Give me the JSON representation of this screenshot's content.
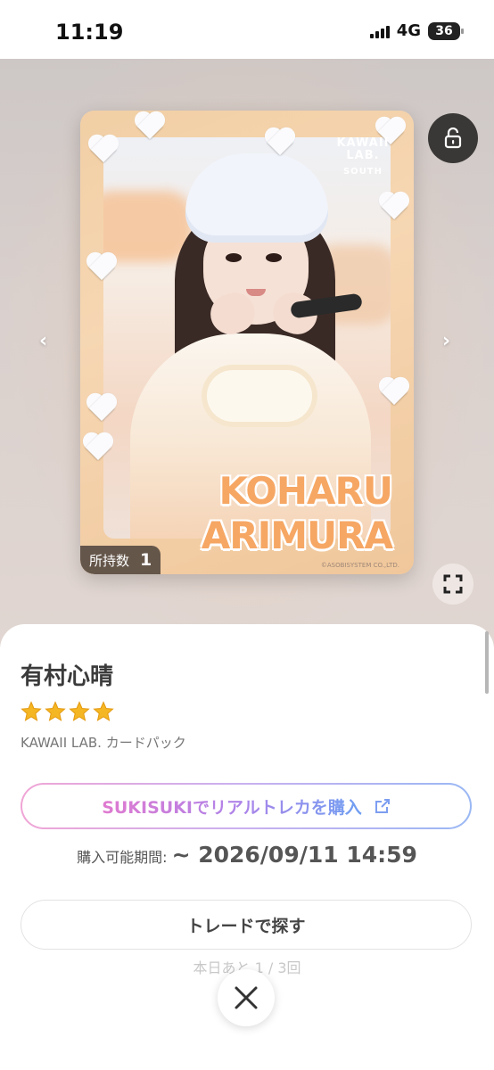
{
  "status_bar": {
    "time": "11:19",
    "network": "4G",
    "battery": "36"
  },
  "card": {
    "logo_line1": "KAWAII",
    "logo_line2": "LAB.",
    "logo_line3": "SOUTH",
    "name_line1": "KOHARU",
    "name_line2": "ARIMURA",
    "copyright": "©ASOBISYSTEM CO.,LTD.",
    "owned_label": "所持数",
    "owned_count": "1"
  },
  "controls": {
    "prev_arrow": "‹",
    "next_arrow": "›"
  },
  "detail": {
    "name": "有村心晴",
    "rating": 4,
    "pack": "KAWAII LAB. カードパック",
    "buy_button": "SUKISUKIでリアルトレカを購入",
    "period_label": "購入可能期間:",
    "period_value": "~ 2026/09/11 14:59",
    "trade_button": "トレードで探す",
    "trade_limit": "本日あと 1 / 3回"
  },
  "colors": {
    "card_frame": "#f2cfa5",
    "name_text": "#f6a764",
    "buy_gradient_start": "#e07ad0",
    "buy_gradient_end": "#6f9ff2",
    "star": "#f5b623"
  },
  "icons": {
    "lock": "unlock-icon",
    "expand": "expand-icon",
    "external_link": "external-link-icon",
    "close": "close-icon"
  }
}
